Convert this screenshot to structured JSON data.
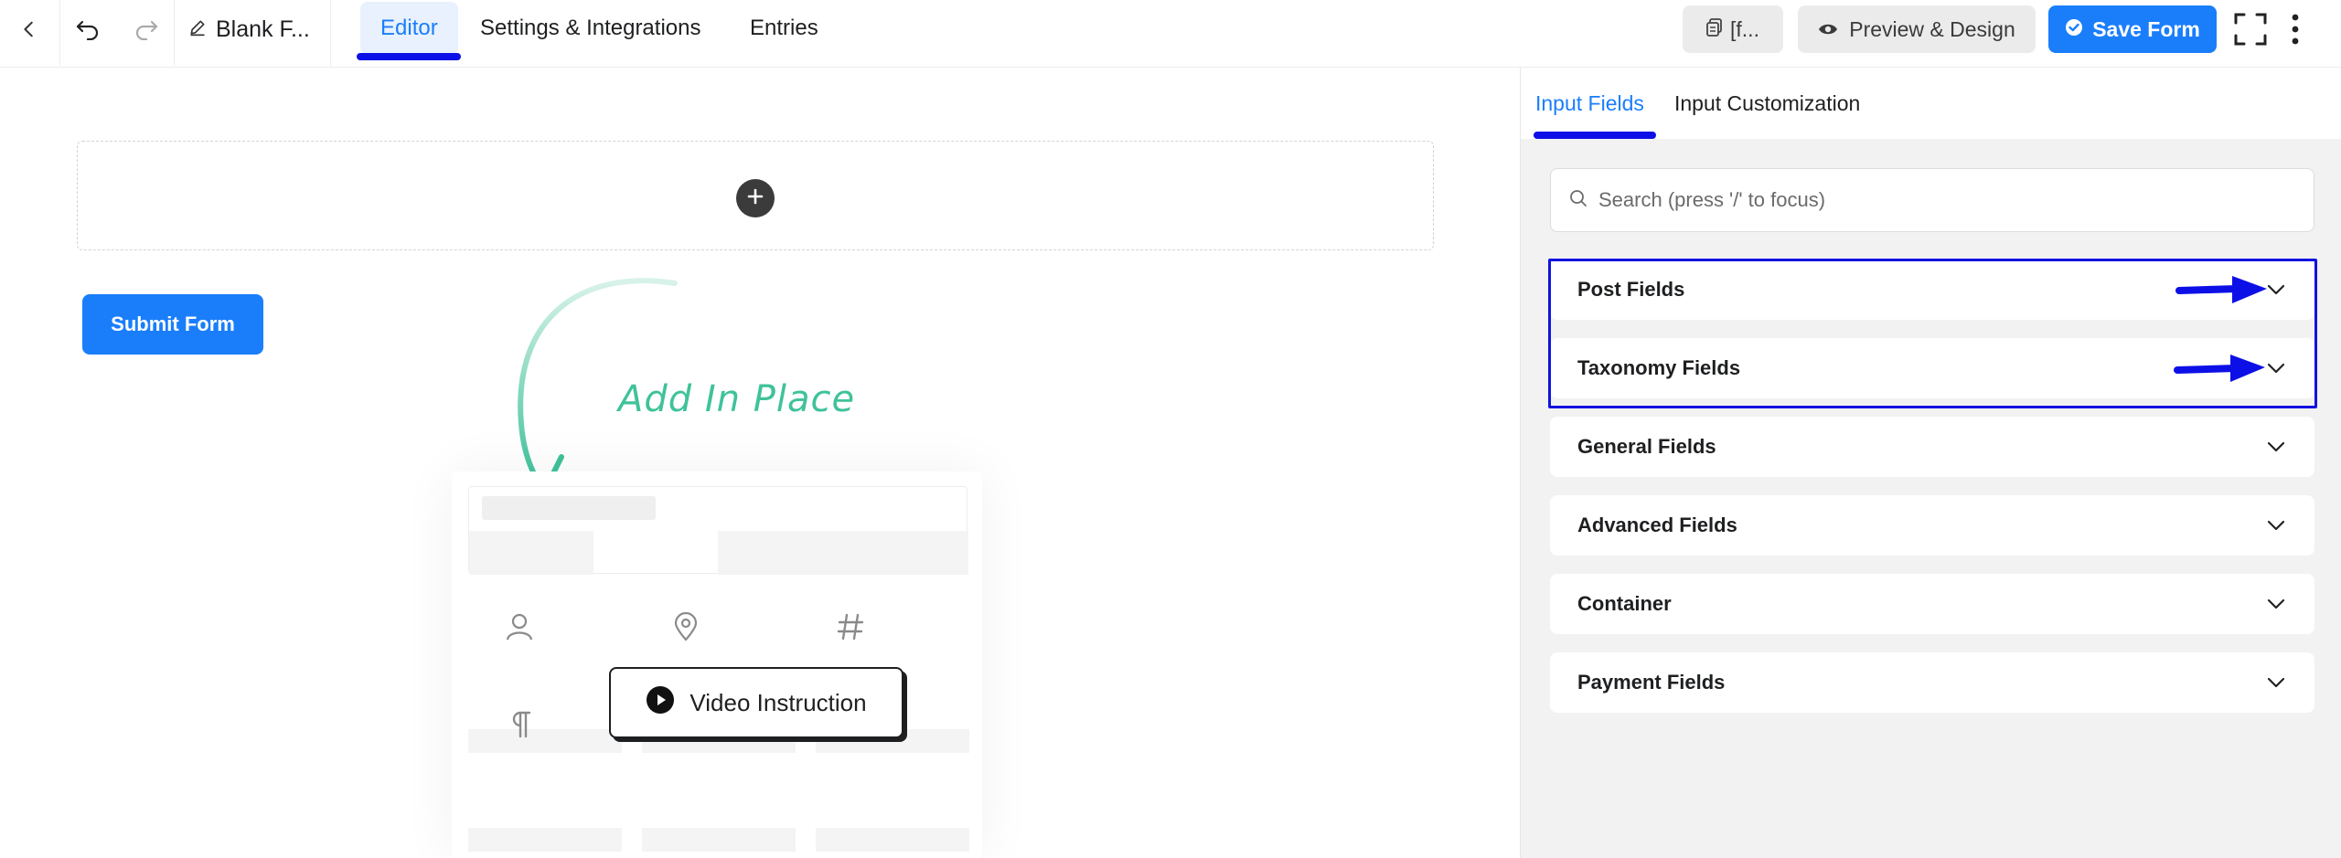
{
  "topbar": {
    "form_title": "Blank F...",
    "tabs": [
      {
        "label": "Editor",
        "active": true
      },
      {
        "label": "Settings & Integrations",
        "active": false
      },
      {
        "label": "Entries",
        "active": false
      }
    ],
    "shortcode_label": "[f...",
    "preview_label": "Preview & Design",
    "save_label": "Save Form"
  },
  "canvas": {
    "submit_label": "Submit Form",
    "hint_text": "Add In Place",
    "video_label": "Video Instruction"
  },
  "sidebar": {
    "tabs": [
      {
        "label": "Input Fields",
        "active": true
      },
      {
        "label": "Input Customization",
        "active": false
      }
    ],
    "search_placeholder": "Search (press '/' to focus)",
    "groups": [
      {
        "label": "Post Fields",
        "highlighted": true
      },
      {
        "label": "Taxonomy Fields",
        "highlighted": true
      },
      {
        "label": "General Fields",
        "highlighted": false
      },
      {
        "label": "Advanced Fields",
        "highlighted": false
      },
      {
        "label": "Container",
        "highlighted": false
      },
      {
        "label": "Payment Fields",
        "highlighted": false
      }
    ]
  },
  "colors": {
    "accent": "#1a7efb",
    "annotation": "#0d10e6",
    "hint_green": "#3fc29a"
  }
}
